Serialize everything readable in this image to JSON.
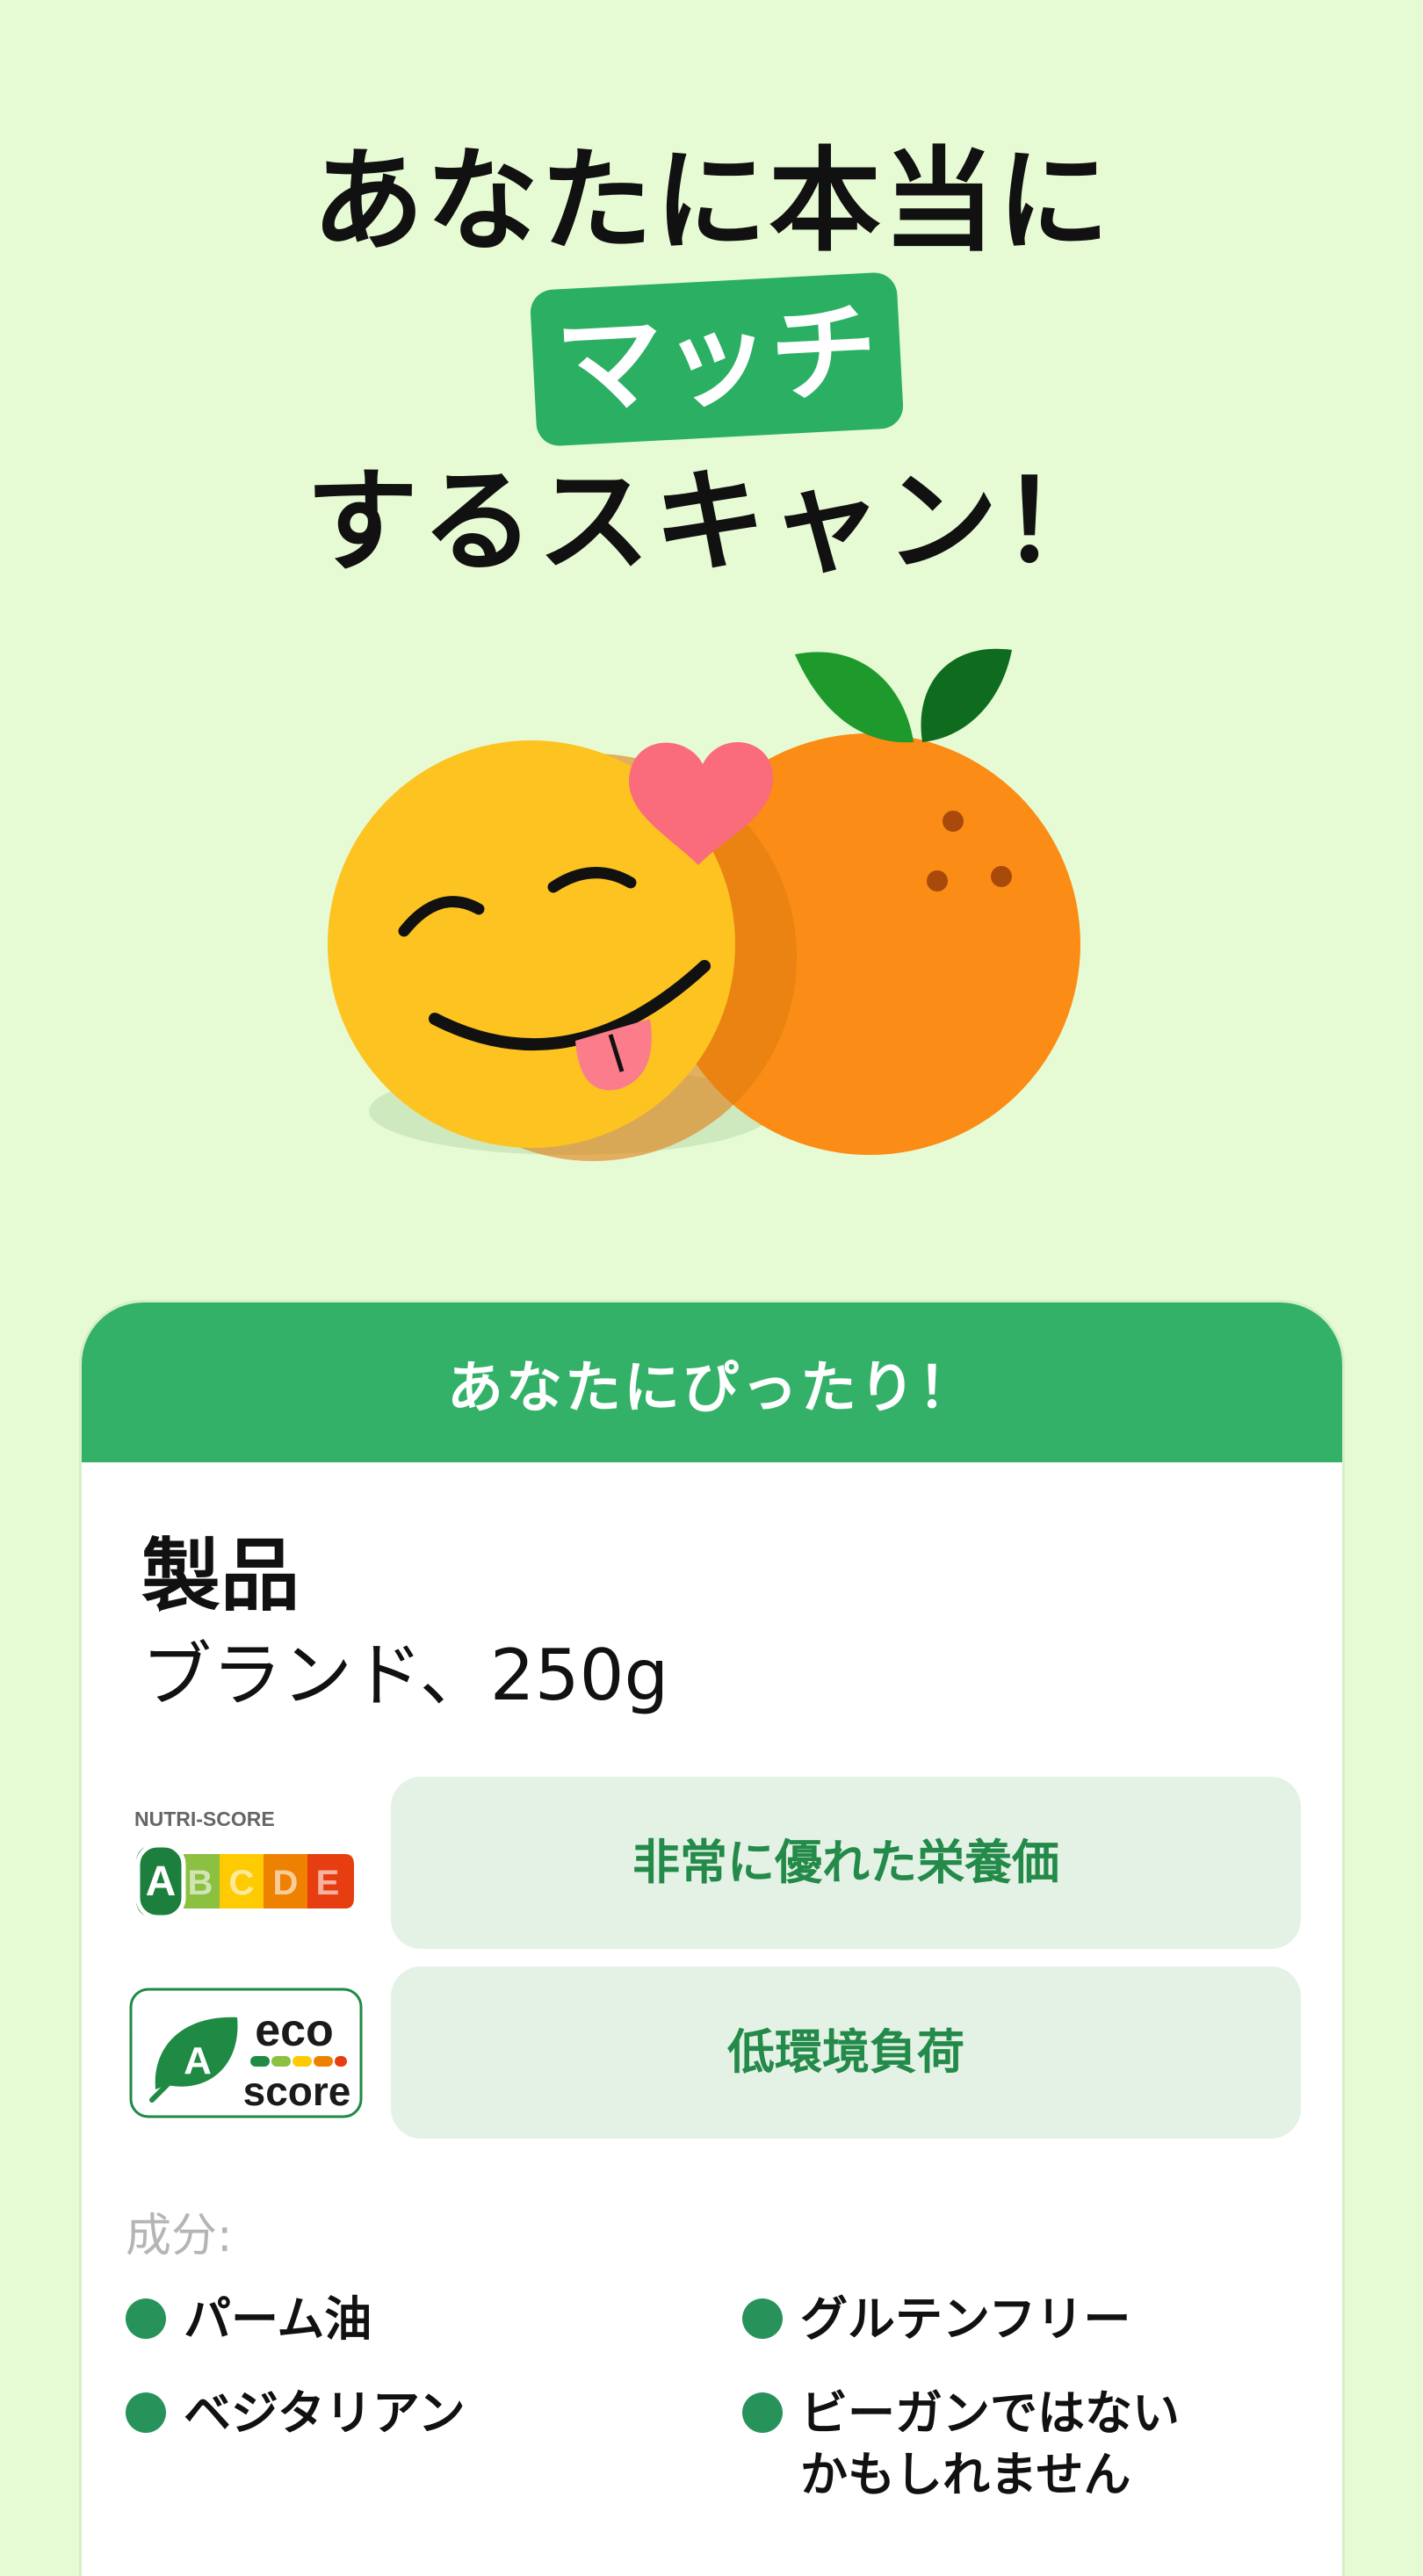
{
  "headline": {
    "line1": "あなたに本当に",
    "highlight": "マッチ",
    "line3": "するスキャン！"
  },
  "card": {
    "header": "あなたにぴったり！",
    "product_title": "製品",
    "product_subtitle": "ブランド、250g",
    "nutri_score": {
      "logo_label": "NUTRI-SCORE",
      "letters": [
        "A",
        "B",
        "C",
        "D",
        "E"
      ],
      "grade": "A",
      "description": "非常に優れた栄養価"
    },
    "eco_score": {
      "grade": "A",
      "logo_top": "eco",
      "logo_bottom": "score",
      "description": "低環境負荷"
    },
    "ingredients_label": "成分:",
    "ingredients": [
      {
        "text": "パーム油"
      },
      {
        "text": "グルテンフリー"
      },
      {
        "text": "ベジタリアン"
      },
      {
        "text": "ビーガンではない\nかもしれません"
      }
    ]
  },
  "colors": {
    "background": "#e6fbd4",
    "brand_green": "#34b168",
    "box_bg": "#e4f2e6",
    "box_text": "#238a49"
  }
}
